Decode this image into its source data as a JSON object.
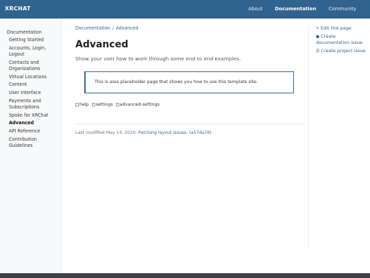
{
  "navbar": {
    "brand": "XRCHAT",
    "links": [
      {
        "label": "About"
      },
      {
        "label": "Documentation"
      },
      {
        "label": "Community"
      }
    ]
  },
  "sidebar": {
    "root": "Documentation",
    "items": [
      "Getting Started",
      "Accounts, Login, Logout",
      "Contacts and Organizations",
      "Virtual Locations",
      "Content",
      "User Interface",
      "Payments and Subscriptions",
      "Spoke for XRChat",
      "Advanced",
      "API Reference",
      "Contribution Guidelines"
    ],
    "active": "Advanced"
  },
  "breadcrumb": {
    "parent": "Documentation",
    "current": "Advanced",
    "separator": "/"
  },
  "page": {
    "title": "Advanced",
    "lead": "Show your user how to work through some end to end examples.",
    "alert": "This is asss placeholder page that shows you how to use this template site.",
    "images": [
      "help",
      "settings",
      "advanced-settings"
    ],
    "modified_prefix": "Last modified May 14, 2020: ",
    "modified_link": "Patching layout issues. (a57da76)"
  },
  "toc": {
    "edit": "Edit this page",
    "create_doc": "Create documentation issue",
    "create_project": "Create project issue"
  },
  "colors": {
    "primary": "#30638e",
    "footer": "#403f4c"
  }
}
